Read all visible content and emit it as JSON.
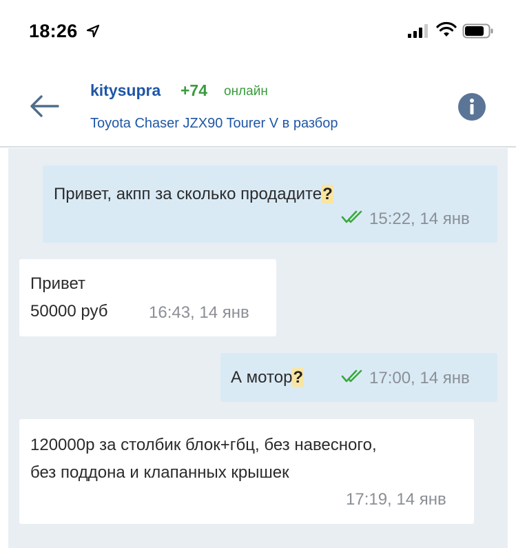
{
  "status_bar": {
    "time": "18:26",
    "icons": [
      "location-arrow-icon",
      "cellular-signal-icon",
      "wifi-icon",
      "battery-icon"
    ]
  },
  "header": {
    "username": "kitysupra",
    "rating": "+74",
    "status": "онлайн",
    "subtitle": "Toyota Chaser JZX90 Tourer V в разбор",
    "icons": [
      "back-arrow-icon",
      "info-icon"
    ]
  },
  "colors": {
    "link_blue": "#1e56a6",
    "online_green": "#3a9b3e",
    "outgoing_bubble": "#d9eaf5",
    "incoming_bubble": "#ffffff",
    "chat_background": "#e9eef3",
    "read_check": "#3aa83a",
    "question_highlight": "#f9e5a0"
  },
  "messages": [
    {
      "direction": "out",
      "text": "Привет, акпп за сколько продадите",
      "highlight": "?",
      "time": "15:22, 14 янв",
      "read": true
    },
    {
      "direction": "in",
      "lines": [
        "Привет",
        "50000 руб"
      ],
      "time": "16:43, 14 янв"
    },
    {
      "direction": "out",
      "text": "А мотор",
      "highlight": "?",
      "time": "17:00, 14 янв",
      "read": true
    },
    {
      "direction": "in",
      "lines": [
        "120000р за столбик блок+гбц, без навесного,",
        "без поддона и клапанных крышек"
      ],
      "time": "17:19, 14 янв"
    }
  ]
}
